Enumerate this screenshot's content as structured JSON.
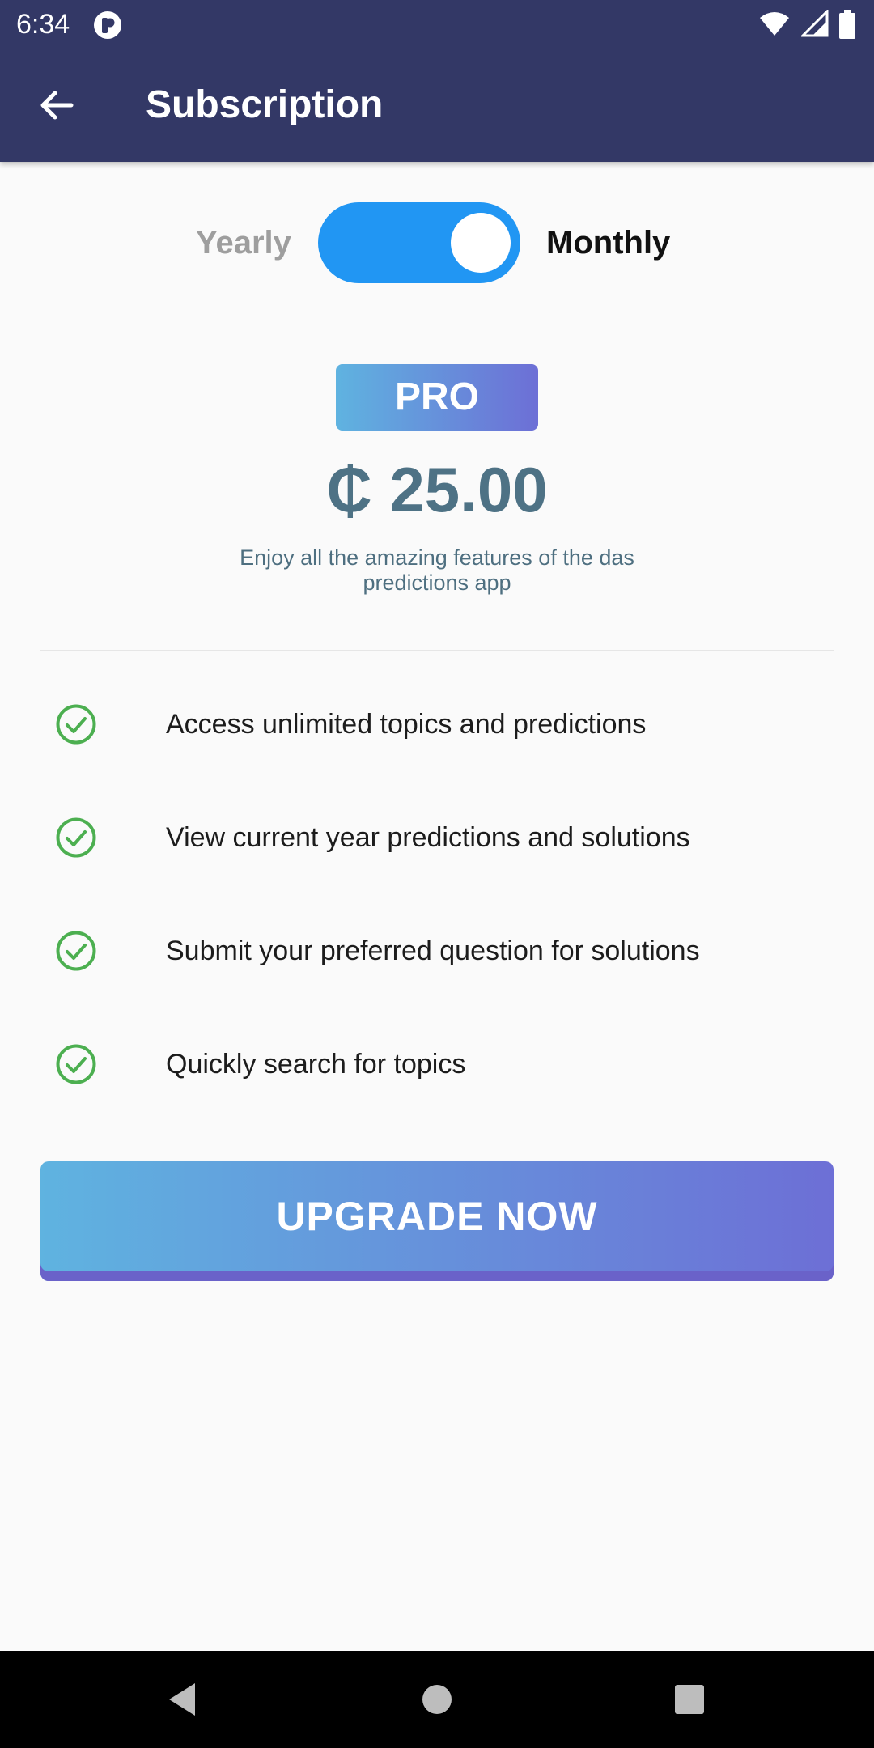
{
  "status_bar": {
    "time": "6:34",
    "icons": [
      "app-notification-icon",
      "wifi-icon",
      "signal-icon",
      "battery-icon"
    ]
  },
  "app_bar": {
    "title": "Subscription",
    "back_icon": "arrow-left-icon",
    "color": "#333866"
  },
  "billing_toggle": {
    "left_label": "Yearly",
    "right_label": "Monthly",
    "selected": "Monthly",
    "color": "#2196f3"
  },
  "plan": {
    "badge": "PRO",
    "price": "₵ 25.00",
    "description": "Enjoy all the amazing features of the das predictions app"
  },
  "features": [
    {
      "icon": "check-circle-icon",
      "text": "Access unlimited topics and predictions"
    },
    {
      "icon": "check-circle-icon",
      "text": "View current year predictions and solutions"
    },
    {
      "icon": "check-circle-icon",
      "text": "Submit your preferred question for solutions"
    },
    {
      "icon": "check-circle-icon",
      "text": "Quickly search for topics"
    }
  ],
  "cta": {
    "label": "UPGRADE NOW",
    "gradient_start": "#5fb3e0",
    "gradient_end": "#6d6fd6"
  },
  "nav_bar": {
    "buttons": [
      "back-triangle-icon",
      "home-circle-icon",
      "recents-square-icon"
    ]
  },
  "colors": {
    "check": "#4caf50",
    "price": "#4e7285"
  }
}
